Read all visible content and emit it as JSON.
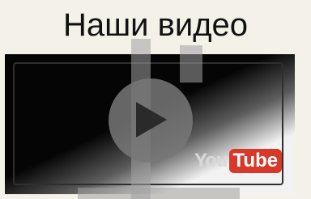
{
  "header": {
    "title": "Наши видео"
  },
  "video": {
    "play_icon": "play-icon",
    "logo": {
      "you": "You",
      "tube": "Tube"
    }
  },
  "colors": {
    "background": "#f3f1e8",
    "frame": "#050505",
    "youtube_red": "#d8382a"
  }
}
